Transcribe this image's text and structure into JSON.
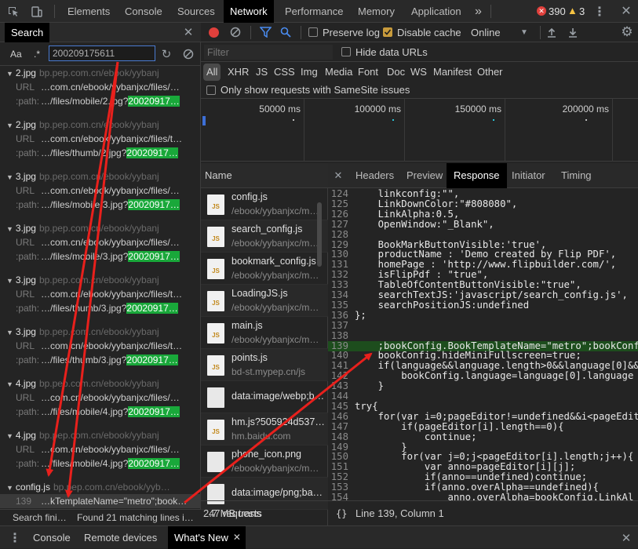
{
  "main_tabs": [
    "Elements",
    "Console",
    "Sources",
    "Network",
    "Performance",
    "Memory",
    "Application"
  ],
  "more_tabs": "»",
  "errors": "390",
  "warnings": "3",
  "search": {
    "tab_label": "Search",
    "case_label": "Aa",
    "regex_label": ".*",
    "query": "200209175611",
    "results": [
      {
        "file": "2.jpg",
        "host": "bp.pep.com.cn/ebook/yybanj",
        "lines": [
          {
            "label": "URL",
            "text": "…com.cn/ebook/yybanjxc/files/…",
            "hl": ""
          },
          {
            "label": ":path:",
            "text": "…/files/mobile/2.jpg?",
            "hl": "20020917…"
          }
        ]
      },
      {
        "file": "2.jpg",
        "host": "bp.pep.com.cn/ebook/yybanj",
        "lines": [
          {
            "label": "URL",
            "text": "…com.cn/ebook/yybanjxc/files/t…",
            "hl": ""
          },
          {
            "label": ":path:",
            "text": "…/files/thumb/2.jpg?",
            "hl": "20020917…"
          }
        ]
      },
      {
        "file": "3.jpg",
        "host": "bp.pep.com.cn/ebook/yybanj",
        "lines": [
          {
            "label": "URL",
            "text": "…com.cn/ebook/yybanjxc/files/…",
            "hl": ""
          },
          {
            "label": ":path:",
            "text": "…/files/mobile/3.jpg?",
            "hl": "20020917…"
          }
        ]
      },
      {
        "file": "3.jpg",
        "host": "bp.pep.com.cn/ebook/yybanj",
        "lines": [
          {
            "label": "URL",
            "text": "…com.cn/ebook/yybanjxc/files/…",
            "hl": ""
          },
          {
            "label": ":path:",
            "text": "…/files/mobile/3.jpg?",
            "hl": "20020917…"
          }
        ]
      },
      {
        "file": "3.jpg",
        "host": "bp.pep.com.cn/ebook/yybanj",
        "lines": [
          {
            "label": "URL",
            "text": "…com.cn/ebook/yybanjxc/files/t…",
            "hl": ""
          },
          {
            "label": ":path:",
            "text": "…/files/thumb/3.jpg?",
            "hl": "20020917…"
          }
        ]
      },
      {
        "file": "3.jpg",
        "host": "bp.pep.com.cn/ebook/yybanj",
        "lines": [
          {
            "label": "URL",
            "text": "…com.cn/ebook/yybanjxc/files/t…",
            "hl": ""
          },
          {
            "label": ":path:",
            "text": "…/files/thumb/3.jpg?",
            "hl": "20020917…"
          }
        ]
      },
      {
        "file": "4.jpg",
        "host": "bp.pep.com.cn/ebook/yybanj",
        "lines": [
          {
            "label": "URL",
            "text": "…com.cn/ebook/yybanjxc/files/…",
            "hl": ""
          },
          {
            "label": ":path:",
            "text": "…/files/mobile/4.jpg?",
            "hl": "20020917…"
          }
        ]
      },
      {
        "file": "4.jpg",
        "host": "bp.pep.com.cn/ebook/yybanj",
        "lines": [
          {
            "label": "URL",
            "text": "…com.cn/ebook/yybanjxc/files/…",
            "hl": ""
          },
          {
            "label": ":path:",
            "text": "…/files/mobile/4.jpg?",
            "hl": "20020917…"
          }
        ]
      },
      {
        "file": "config.js",
        "host": "bp.pep.com.cn/ebook/yyb…",
        "lines": [
          {
            "label": "139",
            "text": "…kTemplateName=\"metro\";book…",
            "hl": ""
          }
        ]
      }
    ],
    "status_left": "Search fini…",
    "status_right": "Found 21 matching lines i…"
  },
  "network": {
    "preserve_log": "Preserve log",
    "disable_cache": "Disable cache",
    "throttle": "Online",
    "filter_placeholder": "Filter",
    "hide_data_urls": "Hide data URLs",
    "types": [
      "All",
      "XHR",
      "JS",
      "CSS",
      "Img",
      "Media",
      "Font",
      "Doc",
      "WS",
      "Manifest",
      "Other"
    ],
    "samesite": "Only show requests with SameSite issues",
    "ticks": [
      "50000 ms",
      "100000 ms",
      "150000 ms",
      "200000 ms"
    ],
    "name_header": "Name",
    "requests": [
      {
        "name": "config.js",
        "path": "/ebook/yybanjxc/m…",
        "icon": "js"
      },
      {
        "name": "search_config.js",
        "path": "/ebook/yybanjxc/m…",
        "icon": "js"
      },
      {
        "name": "bookmark_config.js",
        "path": "/ebook/yybanjxc/m…",
        "icon": "js"
      },
      {
        "name": "LoadingJS.js",
        "path": "/ebook/yybanjxc/m…",
        "icon": "js"
      },
      {
        "name": "main.js",
        "path": "/ebook/yybanjxc/m…",
        "icon": "js"
      },
      {
        "name": "points.js",
        "path": "bd-st.mypep.cn/js",
        "icon": "js"
      },
      {
        "name": "data:image/webp;b…",
        "path": "",
        "icon": "img"
      },
      {
        "name": "hm.js?505924d537…",
        "path": "hm.baidu.com",
        "icon": "js"
      },
      {
        "name": "phone_icon.png",
        "path": "/ebook/yybanjxc/m…",
        "icon": "img"
      },
      {
        "name": "data:image/png;ba…",
        "path": "",
        "icon": "img"
      }
    ],
    "requests_count": "47 requests",
    "transferred": "2.7 MB trans",
    "detail_tabs": [
      "Headers",
      "Preview",
      "Response",
      "Initiator",
      "Timing"
    ],
    "code": [
      {
        "n": "124",
        "t": "    linkconfig:\"\","
      },
      {
        "n": "125",
        "t": "    LinkDownColor:\"#808080\","
      },
      {
        "n": "126",
        "t": "    LinkAlpha:0.5,"
      },
      {
        "n": "127",
        "t": "    OpenWindow:\"_Blank\","
      },
      {
        "n": "128",
        "t": ""
      },
      {
        "n": "129",
        "t": "    BookMarkButtonVisible:'true',"
      },
      {
        "n": "130",
        "t": "    productName : 'Demo created by Flip PDF',"
      },
      {
        "n": "131",
        "t": "    homePage : 'http://www.flipbuilder.com/',"
      },
      {
        "n": "132",
        "t": "    isFlipPdf : \"true\","
      },
      {
        "n": "133",
        "t": "    TableOfContentButtonVisible:\"true\","
      },
      {
        "n": "134",
        "t": "    searchTextJS:'javascript/search_config.js',"
      },
      {
        "n": "135",
        "t": "    searchPositionJS:undefined"
      },
      {
        "n": "136",
        "t": "};"
      },
      {
        "n": "137",
        "t": ""
      },
      {
        "n": "138",
        "t": ""
      },
      {
        "n": "139",
        "t": "    ;bookConfig.BookTemplateName=\"metro\";bookConfi"
      },
      {
        "n": "140",
        "t": "    bookConfig.hideMiniFullscreen=true;"
      },
      {
        "n": "141",
        "t": "    if(language&&language.length>0&&language[0]&&l"
      },
      {
        "n": "142",
        "t": "        bookConfig.language=language[0].language"
      },
      {
        "n": "143",
        "t": "    }"
      },
      {
        "n": "144",
        "t": ""
      },
      {
        "n": "145",
        "t": "try{"
      },
      {
        "n": "146",
        "t": "    for(var i=0;pageEditor!=undefined&&i<pageEdito"
      },
      {
        "n": "147",
        "t": "        if(pageEditor[i].length==0){"
      },
      {
        "n": "148",
        "t": "            continue;"
      },
      {
        "n": "149",
        "t": "        }"
      },
      {
        "n": "150",
        "t": "        for(var j=0;j<pageEditor[i].length;j++){"
      },
      {
        "n": "151",
        "t": "            var anno=pageEditor[i][j];"
      },
      {
        "n": "152",
        "t": "            if(anno==undefined)continue;"
      },
      {
        "n": "153",
        "t": "            if(anno.overAlpha==undefined){"
      },
      {
        "n": "154",
        "t": "                anno.overAlpha=bookConfig.LinkAl"
      }
    ],
    "format_label": "{}",
    "cursor": "Line 139, Column 1"
  },
  "drawer": {
    "tabs": [
      "Console",
      "Remote devices",
      "What's New"
    ]
  }
}
